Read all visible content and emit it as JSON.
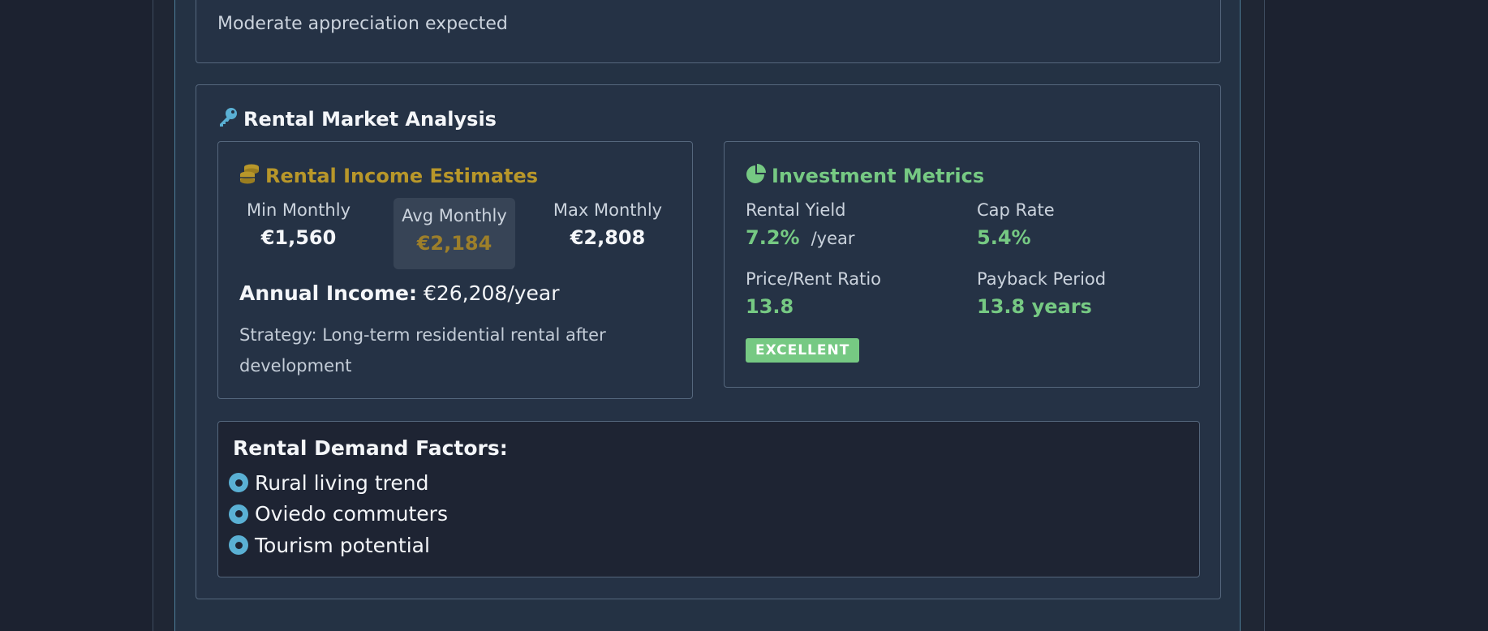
{
  "top_card": {
    "text": "Moderate appreciation expected"
  },
  "rental_section": {
    "title": "Rental Market Analysis",
    "icon": "key-icon",
    "income": {
      "title": "Rental Income Estimates",
      "icon": "coins-icon",
      "min_label": "Min Monthly",
      "min_value": "€1,560",
      "avg_label": "Avg Monthly",
      "avg_value": "€2,184",
      "max_label": "Max Monthly",
      "max_value": "€2,808",
      "annual_label": "Annual Income:",
      "annual_value": "€26,208/year",
      "strategy": "Strategy: Long-term residential rental after development"
    },
    "metrics": {
      "title": "Investment Metrics",
      "icon": "pie-chart-icon",
      "rental_yield_label": "Rental Yield",
      "rental_yield_value": "7.2%",
      "rental_yield_unit": "/year",
      "cap_rate_label": "Cap Rate",
      "cap_rate_value": "5.4%",
      "price_rent_label": "Price/Rent Ratio",
      "price_rent_value": "13.8",
      "payback_label": "Payback Period",
      "payback_value": "13.8 years",
      "badge": "EXCELLENT"
    },
    "demand": {
      "title": "Rental Demand Factors:",
      "items": [
        "Rural living trend",
        "Oviedo commuters",
        "Tourism potential"
      ]
    }
  },
  "colors": {
    "background": "#1c2230",
    "panel": "#243244",
    "gold": "#b8972a",
    "green": "#76c983",
    "accent_blue": "#5ab0d4"
  }
}
